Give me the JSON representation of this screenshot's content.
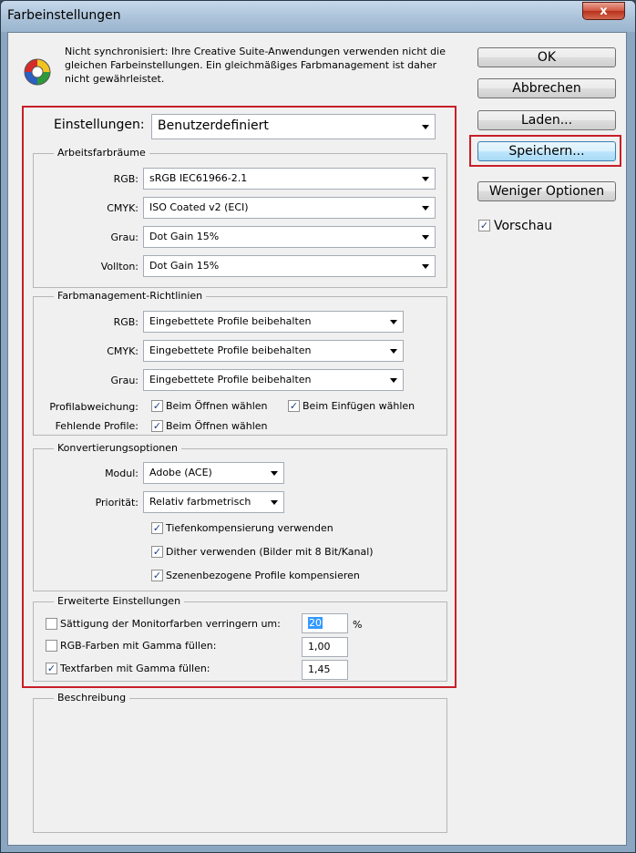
{
  "window": {
    "title": "Farbeinstellungen",
    "close_glyph": "x"
  },
  "warning": {
    "icon": "color-wheel-icon",
    "text": "Nicht synchronisiert: Ihre Creative Suite-Anwendungen verwenden nicht die gleichen Farbeinstellungen. Ein gleichmäßiges Farbmanagement ist daher nicht gewährleistet."
  },
  "settings": {
    "label": "Einstellungen:",
    "value": "Benutzerdefiniert"
  },
  "workspaces": {
    "title": "Arbeitsfarbräume",
    "rows": [
      {
        "label": "RGB:",
        "value": "sRGB IEC61966-2.1"
      },
      {
        "label": "CMYK:",
        "value": "ISO Coated v2 (ECI)"
      },
      {
        "label": "Grau:",
        "value": "Dot Gain 15%"
      },
      {
        "label": "Vollton:",
        "value": "Dot Gain 15%"
      }
    ]
  },
  "policies": {
    "title": "Farbmanagement-Richtlinien",
    "rows": [
      {
        "label": "RGB:",
        "value": "Eingebettete Profile beibehalten"
      },
      {
        "label": "CMYK:",
        "value": "Eingebettete Profile beibehalten"
      },
      {
        "label": "Grau:",
        "value": "Eingebettete Profile beibehalten"
      }
    ],
    "mismatch_label": "Profilabweichung:",
    "mismatch_open": {
      "label": "Beim Öffnen wählen",
      "checked": true
    },
    "mismatch_paste": {
      "label": "Beim Einfügen wählen",
      "checked": true
    },
    "missing_label": "Fehlende Profile:",
    "missing_open": {
      "label": "Beim Öffnen wählen",
      "checked": true
    }
  },
  "conversion": {
    "title": "Konvertierungsoptionen",
    "engine_label": "Modul:",
    "engine_value": "Adobe (ACE)",
    "intent_label": "Priorität:",
    "intent_value": "Relativ farbmetrisch",
    "options": [
      {
        "label": "Tiefenkompensierung verwenden",
        "checked": true
      },
      {
        "label": "Dither verwenden (Bilder mit 8 Bit/Kanal)",
        "checked": true
      },
      {
        "label": "Szenenbezogene Profile kompensieren",
        "checked": true
      }
    ]
  },
  "advanced": {
    "title": "Erweiterte Einstellungen",
    "desaturate": {
      "label": "Sättigung der Monitorfarben verringern um:",
      "checked": false,
      "value": "20",
      "unit": "%"
    },
    "blend_rgb": {
      "label": "RGB-Farben mit Gamma füllen:",
      "checked": false,
      "value": "1,00"
    },
    "blend_text": {
      "label": "Textfarben mit Gamma füllen:",
      "checked": true,
      "value": "1,45"
    }
  },
  "description": {
    "title": "Beschreibung"
  },
  "buttons": {
    "ok": "OK",
    "cancel": "Abbrechen",
    "load": "Laden...",
    "save": "Speichern...",
    "fewer": "Weniger Optionen",
    "preview": {
      "label": "Vorschau",
      "checked": true
    }
  },
  "check_glyph": "✓"
}
